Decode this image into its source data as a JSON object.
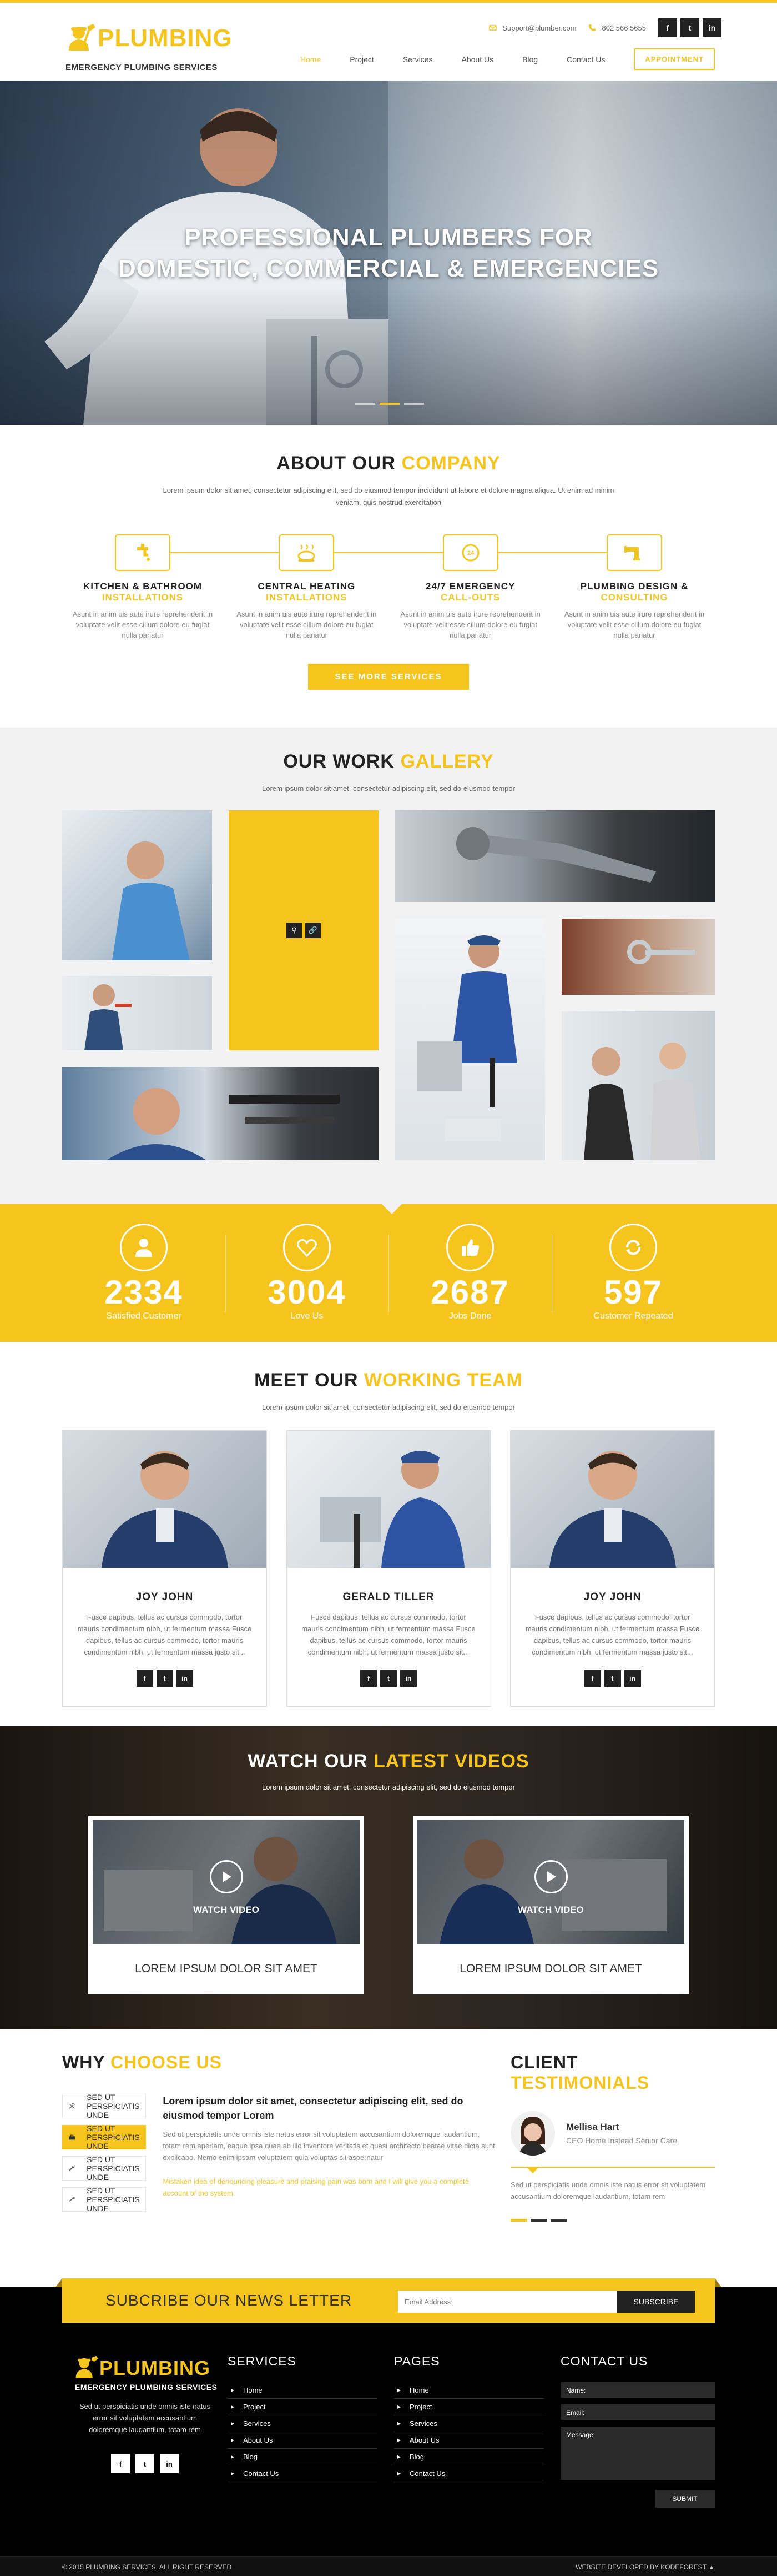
{
  "header": {
    "logo_title": "PLUMBING",
    "logo_subtitle": "EMERGENCY PLUMBING SERVICES",
    "email": "Support@plumber.com",
    "phone": "802 566 5655",
    "social": [
      "f",
      "t",
      "in"
    ],
    "nav": [
      "Home",
      "Project",
      "Services",
      "About Us",
      "Blog",
      "Contact Us"
    ],
    "active_nav": "Home",
    "appointment_label": "APPOINTMENT"
  },
  "hero": {
    "line1": "PROFESSIONAL PLUMBERS FOR",
    "line2": "DOMESTIC, COMMERCIAL & EMERGENCIES"
  },
  "about": {
    "title_a": "ABOUT OUR",
    "title_b": "COMPANY",
    "subtitle": "Lorem ipsum dolor sit amet, consectetur adipiscing elit, sed do eiusmod tempor incididunt ut labore et dolore magna aliqua. Ut enim ad minim veniam, quis nostrud exercitation",
    "services": [
      {
        "t1": "KITCHEN & BATHROOM",
        "t2": "INSTALLATIONS",
        "text": "Asunt in anim uis aute irure reprehenderit in voluptate velit esse cillum dolore eu fugiat nulla pariatur"
      },
      {
        "t1": "CENTRAL HEATING",
        "t2": "INSTALLATIONS",
        "text": "Asunt in anim uis aute irure reprehenderit in voluptate velit esse cillum dolore eu fugiat nulla pariatur"
      },
      {
        "t1": "24/7 EMERGENCY",
        "t2": "CALL-OUTS",
        "text": "Asunt in anim uis aute irure reprehenderit in voluptate velit esse cillum dolore eu fugiat nulla pariatur"
      },
      {
        "t1": "PLUMBING DESIGN &",
        "t2": "CONSULTING",
        "text": "Asunt in anim uis aute irure reprehenderit in voluptate velit esse cillum dolore eu fugiat nulla pariatur"
      }
    ],
    "button": "SEE MORE SERVICES"
  },
  "gallery": {
    "title_a": "OUR WORK",
    "title_b": "GALLERY",
    "subtitle": "Lorem ipsum dolor sit amet, consectetur adipiscing elit, sed do eiusmod tempor"
  },
  "stats": [
    {
      "num": "2334",
      "label": "Satisfied Customer"
    },
    {
      "num": "3004",
      "label": "Love Us"
    },
    {
      "num": "2687",
      "label": "Jobs Done"
    },
    {
      "num": "597",
      "label": "Customer Repeated"
    }
  ],
  "team": {
    "title_a": "MEET OUR",
    "title_b": "WORKING TEAM",
    "subtitle": "Lorem ipsum dolor sit amet, consectetur adipiscing elit, sed do eiusmod tempor",
    "members": [
      {
        "name": "JOY JOHN",
        "text": "Fusce dapibus, tellus ac cursus commodo, tortor mauris condimentum nibh, ut fermentum massa Fusce dapibus, tellus ac cursus commodo, tortor mauris condimentum nibh, ut fermentum massa justo sit..."
      },
      {
        "name": "GERALD TILLER",
        "text": "Fusce dapibus, tellus ac cursus commodo, tortor mauris condimentum nibh, ut fermentum massa Fusce dapibus, tellus ac cursus commodo, tortor mauris condimentum nibh, ut fermentum massa justo sit..."
      },
      {
        "name": "JOY JOHN",
        "text": "Fusce dapibus, tellus ac cursus commodo, tortor mauris condimentum nibh, ut fermentum massa Fusce dapibus, tellus ac cursus commodo, tortor mauris condimentum nibh, ut fermentum massa justo sit..."
      }
    ]
  },
  "videos": {
    "title_a": "WATCH OUR",
    "title_b": "LATEST VIDEOS",
    "subtitle": "Lorem ipsum dolor sit amet, consectetur adipiscing elit, sed do eiusmod tempor",
    "watch_label": "WATCH VIDEO",
    "items": [
      "LOREM IPSUM DOLOR SIT AMET",
      "LOREM IPSUM DOLOR SIT AMET"
    ]
  },
  "why": {
    "title_a": "WHY",
    "title_b": "CHOOSE US",
    "tabs": [
      "SED UT PERSPICIATIS UNDE",
      "SED UT PERSPICIATIS UNDE",
      "SED UT PERSPICIATIS UNDE",
      "SED UT PERSPICIATIS UNDE"
    ],
    "active_tab": 1,
    "heading": "Lorem ipsum dolor sit amet, consectetur adipiscing elit, sed do eiusmod tempor Lorem",
    "para": "Sed ut perspiciatis unde omnis iste natus error sit voluptatem accusantium doloremque laudantium, totam rem aperiam, eaque ipsa quae ab illo inventore veritatis et quasi architecto beatae vitae dicta sunt explicabo. Nemo enim ipsam voluptatem quia voluptas sit aspernatur",
    "highlight": "Mistaken idea of denouncing pleasure and praising pain was born and I will give you a complete account of the system."
  },
  "testimonials": {
    "title_a": "CLIENT",
    "title_b": "TESTIMONIALS",
    "name": "Mellisa Hart",
    "role": "CEO Home Instead Senior Care",
    "quote": "Sed ut perspiciatis unde omnis iste natus error sit voluptatem accusantium doloremque laudantium, totam rem"
  },
  "footer": {
    "newsletter": "SUBCRIBE OUR NEWS LETTER",
    "email_placeholder": "Email Address:",
    "subscribe": "SUBSCRIBE",
    "about_text": "Sed ut perspiciatis unde omnis iste natus error sit voluptatem accusantium doloremque laudantium, totam rem",
    "services_title": "SERVICES",
    "services": [
      "Home",
      "Project",
      "Services",
      "About Us",
      "Blog",
      "Contact Us"
    ],
    "pages_title": "PAGES",
    "pages": [
      "Home",
      "Project",
      "Services",
      "About Us",
      "Blog",
      "Contact Us"
    ],
    "contact_title": "CONTACT US",
    "name_label": "Name:",
    "email_label": "Email:",
    "message_label": "Message:",
    "submit": "SUBMIT",
    "copyright": "© 2015 PLUMBING SERVICES. ALL RIGHT RESERVED",
    "developer": "WEBSITE DEVELOPED BY KODEFOREST"
  },
  "colors": {
    "accent": "#f5c51e",
    "dark": "#222222",
    "footer": "#000000"
  }
}
